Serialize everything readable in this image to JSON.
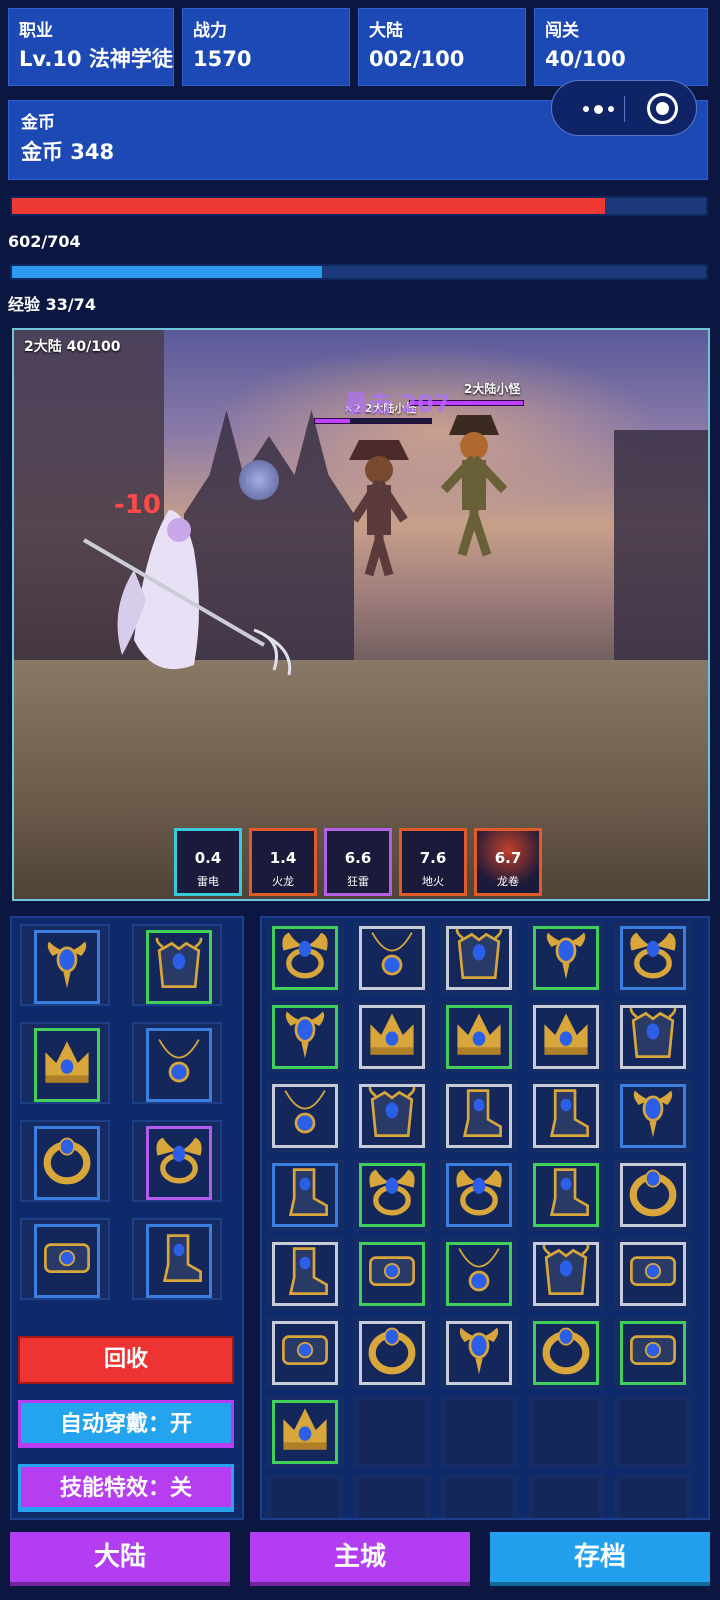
{
  "stats": [
    {
      "label": "职业",
      "value": "Lv.10 法神学徒"
    },
    {
      "label": "战力",
      "value": "1570"
    },
    {
      "label": "大陆",
      "value": "002/100"
    },
    {
      "label": "闯关",
      "value": "40/100"
    }
  ],
  "gold": {
    "label": "金币",
    "value": "金币 348"
  },
  "hp": {
    "text": "602/704",
    "fraction": 0.855,
    "color": "#ef3a33"
  },
  "exp": {
    "text": "经验 33/74",
    "fraction": 0.446,
    "color": "#2b9af0"
  },
  "scene": {
    "stage_label": "2大陆  40/100",
    "enemy_name": "2大陆小怪",
    "enemy_name_2": "×2 2大陆小怪",
    "crit_text": "暴击 207",
    "damage_text": "-10"
  },
  "skills": [
    {
      "cd": "0.4",
      "name": "雷电",
      "color": "#39c9d8"
    },
    {
      "cd": "1.4",
      "name": "火龙",
      "color": "#e05a2a"
    },
    {
      "cd": "6.6",
      "name": "狂雷",
      "color": "#b060e0"
    },
    {
      "cd": "7.6",
      "name": "地火",
      "color": "#e05a2a"
    },
    {
      "cd": "6.7",
      "name": "龙卷",
      "color": "#e05a2a"
    }
  ],
  "equipped": [
    {
      "item": "amulet",
      "rarity": "blue"
    },
    {
      "item": "armor",
      "rarity": "green"
    },
    {
      "item": "crown",
      "rarity": "green"
    },
    {
      "item": "necklace",
      "rarity": "blue"
    },
    {
      "item": "ring",
      "rarity": "blue"
    },
    {
      "item": "winged-ring",
      "rarity": "purple"
    },
    {
      "item": "bracer",
      "rarity": "blue"
    },
    {
      "item": "boots",
      "rarity": "blue"
    }
  ],
  "inventory": [
    {
      "item": "winged-ring",
      "rarity": "green"
    },
    {
      "item": "necklace",
      "rarity": "white"
    },
    {
      "item": "armor",
      "rarity": "white"
    },
    {
      "item": "amulet",
      "rarity": "green"
    },
    {
      "item": "winged-ring",
      "rarity": "blue"
    },
    {
      "item": "amulet",
      "rarity": "green"
    },
    {
      "item": "crown",
      "rarity": "white"
    },
    {
      "item": "crown",
      "rarity": "green"
    },
    {
      "item": "crown",
      "rarity": "white"
    },
    {
      "item": "armor",
      "rarity": "white"
    },
    {
      "item": "necklace",
      "rarity": "white"
    },
    {
      "item": "armor",
      "rarity": "white"
    },
    {
      "item": "boots",
      "rarity": "white"
    },
    {
      "item": "boots",
      "rarity": "white"
    },
    {
      "item": "amulet",
      "rarity": "blue"
    },
    {
      "item": "boots",
      "rarity": "blue"
    },
    {
      "item": "winged-ring",
      "rarity": "green"
    },
    {
      "item": "winged-ring",
      "rarity": "blue"
    },
    {
      "item": "boots",
      "rarity": "green"
    },
    {
      "item": "ring",
      "rarity": "white"
    },
    {
      "item": "boots",
      "rarity": "white"
    },
    {
      "item": "bracer",
      "rarity": "green"
    },
    {
      "item": "necklace",
      "rarity": "green"
    },
    {
      "item": "armor",
      "rarity": "white"
    },
    {
      "item": "bracer",
      "rarity": "white"
    },
    {
      "item": "bracer",
      "rarity": "white"
    },
    {
      "item": "ring",
      "rarity": "white"
    },
    {
      "item": "amulet",
      "rarity": "white"
    },
    {
      "item": "ring",
      "rarity": "green"
    },
    {
      "item": "bracer",
      "rarity": "green"
    },
    {
      "item": "crown",
      "rarity": "green"
    },
    {
      "item": "",
      "rarity": "empty"
    },
    {
      "item": "",
      "rarity": "empty"
    },
    {
      "item": "",
      "rarity": "empty"
    },
    {
      "item": "",
      "rarity": "empty"
    },
    {
      "item": "",
      "rarity": "empty"
    },
    {
      "item": "",
      "rarity": "empty"
    },
    {
      "item": "",
      "rarity": "empty"
    },
    {
      "item": "",
      "rarity": "empty"
    },
    {
      "item": "",
      "rarity": "empty"
    }
  ],
  "rarity_colors": {
    "blue": "#3a7fe0",
    "green": "#3fcf5a",
    "white": "#c8ccd8",
    "purple": "#b35cf0",
    "empty": "#13275a"
  },
  "actions": {
    "recycle": "回收",
    "auto_equip": "自动穿戴：开",
    "skill_fx": "技能特效：关"
  },
  "bottom_nav": {
    "continent": "大陆",
    "main_city": "主城",
    "save": "存档"
  }
}
